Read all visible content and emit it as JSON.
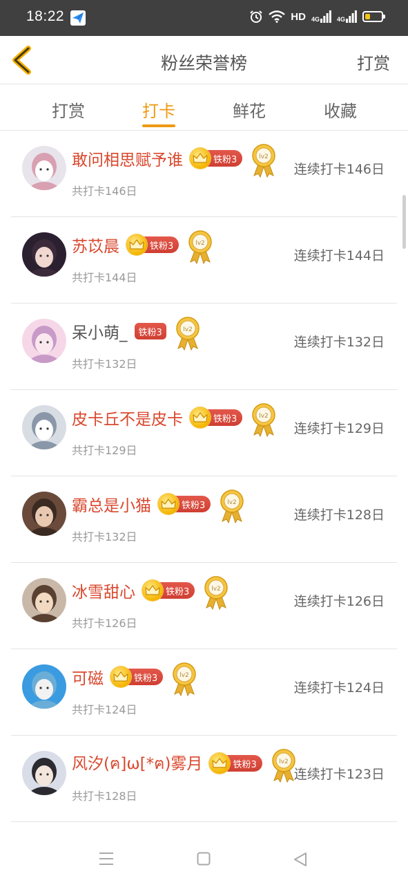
{
  "status": {
    "time": "18:22",
    "hd": "HD",
    "net1": "4G",
    "net2": "4G",
    "battery_level": 0.3
  },
  "header": {
    "title": "粉丝荣誉榜",
    "action": "打赏"
  },
  "tabs": [
    {
      "label": "打赏",
      "active": false
    },
    {
      "label": "打卡",
      "active": true
    },
    {
      "label": "鲜花",
      "active": false
    },
    {
      "label": "收藏",
      "active": false
    }
  ],
  "badge": {
    "fan_label": "铁粉3",
    "medal_label": "lv2"
  },
  "rows": [
    {
      "name": "敢问相思赋予谁",
      "crown": true,
      "subtext": "共打卡146日",
      "streak": "连续打卡146日"
    },
    {
      "name": "苏苡晨",
      "crown": true,
      "subtext": "共打卡144日",
      "streak": "连续打卡144日"
    },
    {
      "name": "呆小萌_",
      "crown": false,
      "subtext": "共打卡132日",
      "streak": "连续打卡132日"
    },
    {
      "name": "皮卡丘不是皮卡",
      "crown": true,
      "subtext": "共打卡129日",
      "streak": "连续打卡129日"
    },
    {
      "name": "霸总是小猫",
      "crown": true,
      "subtext": "共打卡132日",
      "streak": "连续打卡128日"
    },
    {
      "name": "冰雪甜心",
      "crown": true,
      "subtext": "共打卡126日",
      "streak": "连续打卡126日"
    },
    {
      "name": "可磁",
      "crown": true,
      "subtext": "共打卡124日",
      "streak": "连续打卡124日"
    },
    {
      "name": "风汐(ฅ]ω[*ฅ)雾月",
      "crown": true,
      "subtext": "共打卡128日",
      "streak": "连续打卡123日"
    }
  ],
  "colors": {
    "accent": "#ee9a12",
    "name_red": "#d9482e",
    "badge_red": "#cf3f33"
  }
}
